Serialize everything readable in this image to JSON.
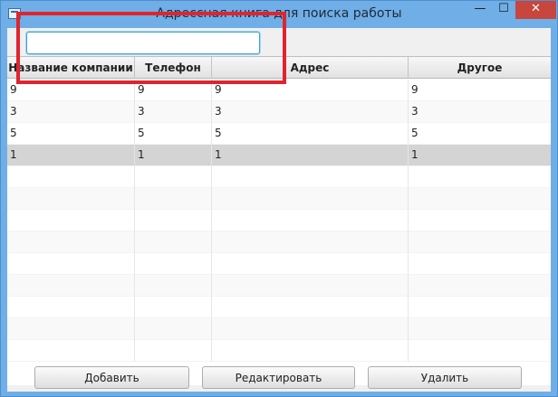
{
  "window": {
    "title": "Адрессная книга для поиска работы",
    "controls": {
      "minimize": "—",
      "maximize": "☐",
      "close": "✕"
    }
  },
  "search": {
    "value": "",
    "placeholder": ""
  },
  "table": {
    "columns": [
      "Название компании",
      "Телефон",
      "Адрес",
      "Другое"
    ],
    "rows": [
      [
        "9",
        "9",
        "9",
        "9"
      ],
      [
        "3",
        "3",
        "3",
        "3"
      ],
      [
        "5",
        "5",
        "5",
        "5"
      ],
      [
        "1",
        "1",
        "1",
        "1"
      ]
    ],
    "selected_row": 3,
    "empty_rows": 9
  },
  "buttons": {
    "add": "Добавить",
    "edit": "Редактировать",
    "delete": "Удалить"
  },
  "colors": {
    "selection": "#d4d4d4",
    "highlight": "#e0242f",
    "focus": "#3ea0d7",
    "close": "#c7463e"
  }
}
